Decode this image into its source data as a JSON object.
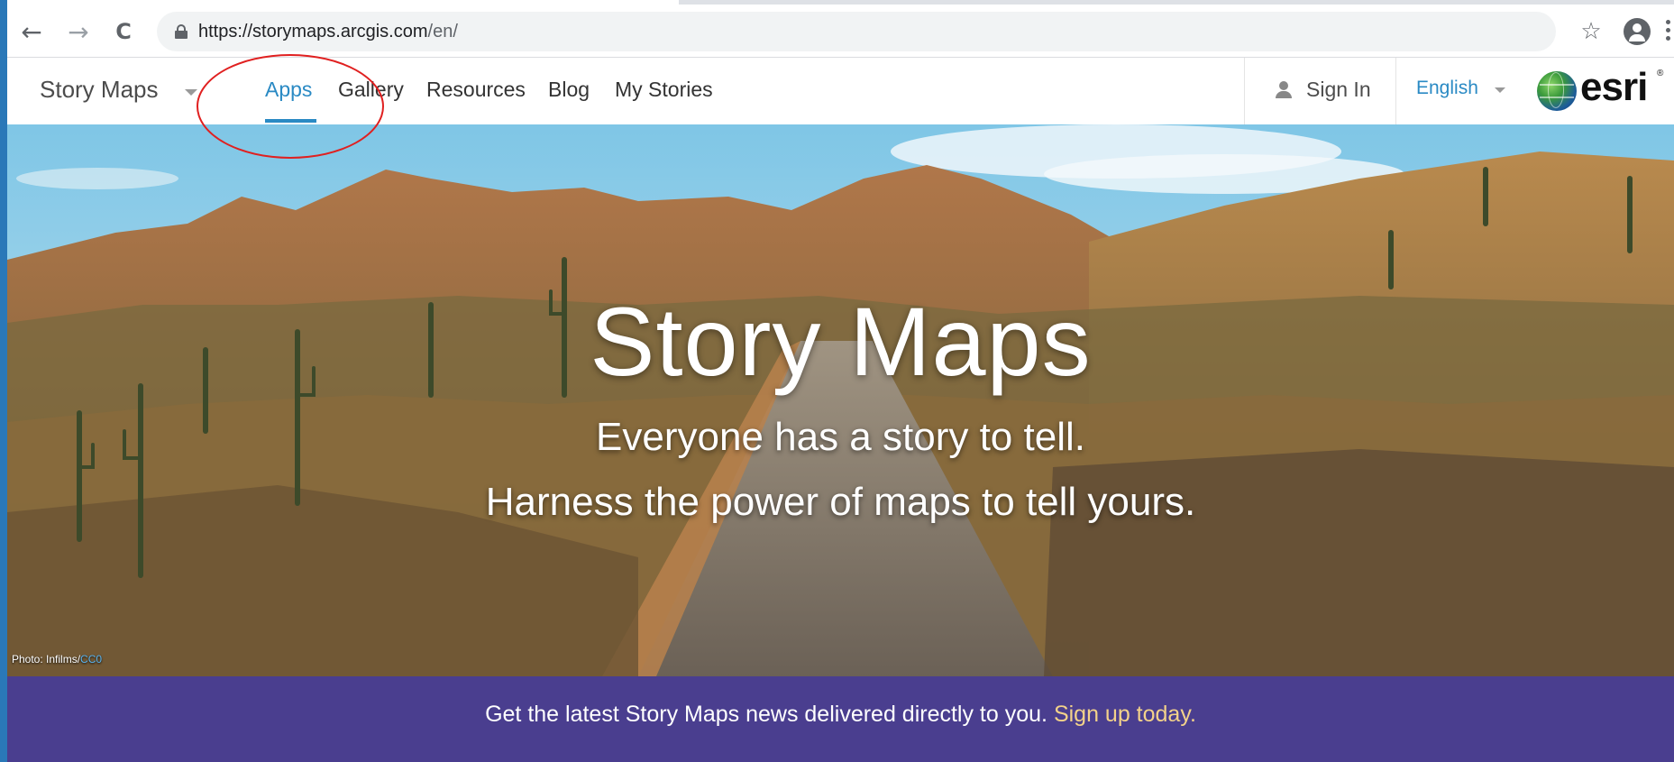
{
  "browser": {
    "url_host": "https://storymaps.arcgis.com",
    "url_path": "/en/",
    "back_glyph": "←",
    "forward_glyph": "→",
    "reload_glyph": "C",
    "star_glyph": "☆",
    "icons": [
      "back-arrow-icon",
      "forward-arrow-icon",
      "reload-icon",
      "lock-icon",
      "bookmark-star-icon",
      "profile-icon",
      "menu-dots-icon"
    ]
  },
  "header": {
    "brand": "Story Maps",
    "nav": [
      "Apps",
      "Gallery",
      "Resources",
      "Blog",
      "My Stories"
    ],
    "active_nav": "Apps",
    "sign_in": "Sign In",
    "language": "English",
    "logo_text": "esri",
    "logo_mark": "®"
  },
  "hero": {
    "title": "Story Maps",
    "subtitle_1": "Everyone has a story to tell.",
    "subtitle_2": "Harness the power of maps to tell yours.",
    "photo_credit_prefix": "Photo: Infilms/",
    "photo_credit_license": "CC0"
  },
  "newsletter": {
    "text": "Get the latest Story Maps news delivered directly to you.",
    "link": "Sign up today."
  },
  "colors": {
    "accent": "#2a8ac4",
    "newsletter_bg": "#4a3e8f",
    "newsletter_link": "#f3d28a",
    "annotation": "#e02020"
  }
}
